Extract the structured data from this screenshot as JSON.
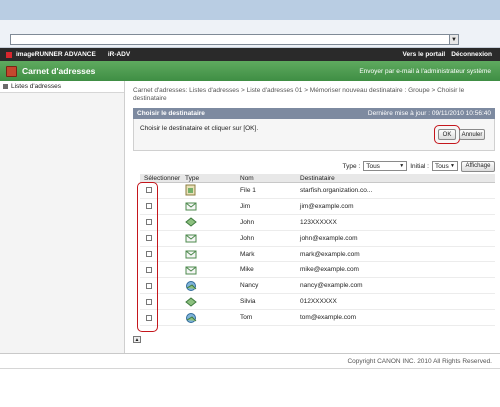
{
  "browser": {
    "url": ""
  },
  "header": {
    "product": "imageRUNNER ADVANCE",
    "model": "iR-ADV",
    "portal_link": "Vers le portail",
    "logout_link": "Déconnexion"
  },
  "titlebar": {
    "title": "Carnet d'adresses",
    "email_admin": "Envoyer par e-mail à l'administrateur système"
  },
  "sidebar": {
    "items": [
      {
        "label": "Listes d'adresses"
      }
    ]
  },
  "breadcrumb": "Carnet d'adresses: Listes d'adresses > Liste d'adresses 01 > Mémoriser nouveau destinataire : Groupe > Choisir le destinataire",
  "dialog": {
    "title": "Choisir le destinataire",
    "last_update": "Dernière mise à jour : 09/11/2010 10:56:40",
    "instruction": "Choisir le destinataire et cliquer sur [OK].",
    "ok_label": "OK",
    "cancel_label": "Annuler"
  },
  "filter": {
    "type_label": "Type :",
    "type_value": "Tous",
    "initial_label": "Initial :",
    "initial_value": "Tous",
    "display_label": "Affichage"
  },
  "table": {
    "headers": {
      "select": "Sélectionner",
      "type": "Type",
      "name": "Nom",
      "dest": "Destinataire"
    },
    "rows": [
      {
        "type_icon": "file-icon",
        "name": "File 1",
        "dest": "starfish.organization.co..."
      },
      {
        "type_icon": "email-icon",
        "name": "Jim",
        "dest": "jim@example.com"
      },
      {
        "type_icon": "fax-icon",
        "name": "John",
        "dest": "123XXXXXX"
      },
      {
        "type_icon": "email-icon",
        "name": "John",
        "dest": "john@example.com"
      },
      {
        "type_icon": "email-icon",
        "name": "Mark",
        "dest": "mark@example.com"
      },
      {
        "type_icon": "email-icon",
        "name": "Mike",
        "dest": "mike@example.com"
      },
      {
        "type_icon": "ifax-icon",
        "name": "Nancy",
        "dest": "nancy@example.com"
      },
      {
        "type_icon": "fax-icon",
        "name": "Silvia",
        "dest": "012XXXXXX"
      },
      {
        "type_icon": "ifax-icon",
        "name": "Tom",
        "dest": "tom@example.com"
      }
    ]
  },
  "footer": "Copyright CANON INC. 2010 All Rights Reserved.",
  "colors": {
    "header_bg": "#2a2a2a",
    "titlebar_green": "#4a9a4f",
    "dialog_head": "#7d8aa0",
    "highlight_red": "#c4161c"
  }
}
